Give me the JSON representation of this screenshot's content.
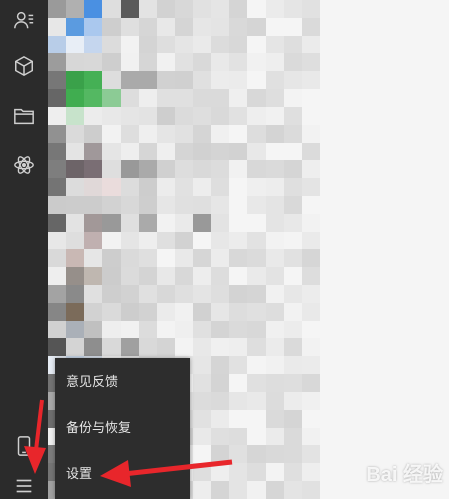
{
  "menu": {
    "items": [
      {
        "label": "意见反馈"
      },
      {
        "label": "备份与恢复"
      },
      {
        "label": "设置"
      }
    ]
  },
  "sidebar": {
    "icons": [
      "contacts-icon",
      "cube-icon",
      "folder-icon",
      "atom-icon",
      "phone-icon",
      "hamburger-menu-icon"
    ]
  },
  "colors": {
    "sidebar_bg": "#2b2b2b",
    "menu_bg": "#2d2d2d",
    "menu_text": "#e6e6e6",
    "arrow": "#e8262b"
  },
  "watermark": {
    "text": "Bai 经验"
  }
}
